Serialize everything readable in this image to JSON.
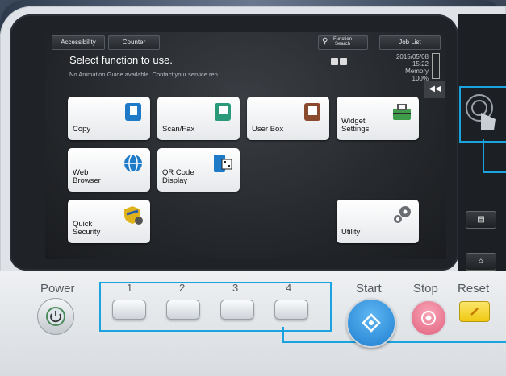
{
  "topbar": {
    "accessibility": "Accessibility",
    "counter": "Counter",
    "function_search": "Function\nSearch",
    "job_list": "Job List"
  },
  "screen": {
    "title": "Select function to use.",
    "subtitle": "No Animation Guide available. Contact your service rep.",
    "date": "2015/05/08",
    "time": "15:22",
    "memory_label": "Memory",
    "memory_value": "100%"
  },
  "tiles": [
    {
      "label": "Copy",
      "icon": "copy-icon",
      "color": "#1f7bc8"
    },
    {
      "label": "Scan/Fax",
      "icon": "scan-fax-icon",
      "color": "#2a9a7b"
    },
    {
      "label": "User Box",
      "icon": "user-box-icon",
      "color": "#8a4a2e"
    },
    {
      "label": "Widget\nSettings",
      "icon": "toolbox-icon",
      "color": "#3e9b4a"
    },
    {
      "label": "Web\nBrowser",
      "icon": "globe-icon",
      "color": "#1f7bc8"
    },
    {
      "label": "QR Code\nDisplay",
      "icon": "qr-code-icon",
      "color": "#1f7bc8"
    },
    {
      "label": "Quick\nSecurity",
      "icon": "security-shield-icon",
      "color": "#e0b21a"
    },
    {
      "label": "Utility",
      "icon": "gears-icon",
      "color": "#6a6e73"
    }
  ],
  "collapse": "◀◀",
  "hardware": {
    "power": "Power",
    "numbers": [
      "1",
      "2",
      "3",
      "4"
    ],
    "start": "Start",
    "stop": "Stop",
    "reset": "Reset"
  },
  "colors": {
    "callout": "#1aa3de",
    "start": "#2a8fe0",
    "stop": "#e86a86",
    "reset": "#f5d21a"
  }
}
